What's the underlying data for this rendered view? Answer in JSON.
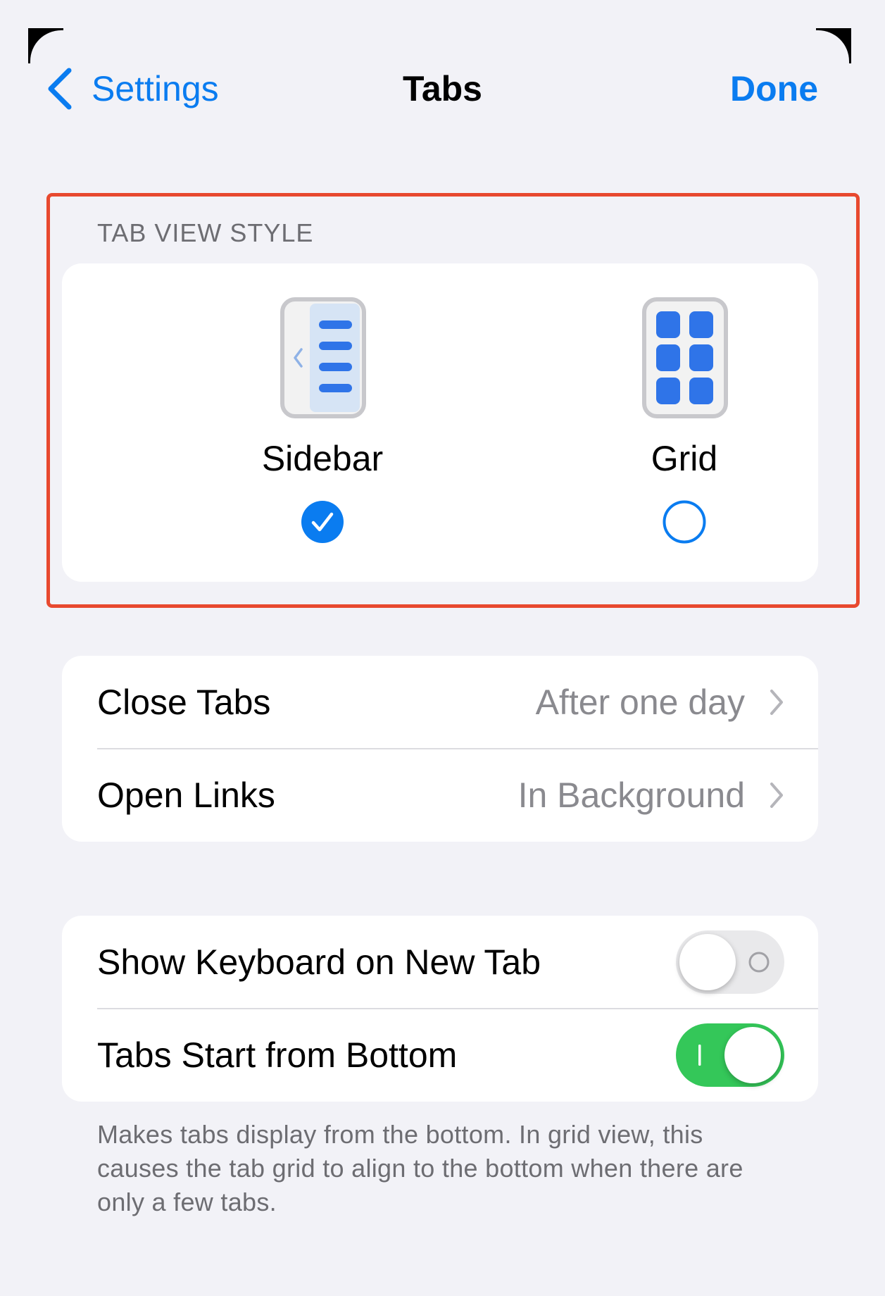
{
  "navbar": {
    "back_label": "Settings",
    "title": "Tabs",
    "done_label": "Done"
  },
  "tab_view_style": {
    "header": "TAB VIEW STYLE",
    "options": [
      {
        "label": "Sidebar",
        "icon": "sidebar-layout-icon",
        "selected": true
      },
      {
        "label": "Grid",
        "icon": "grid-layout-icon",
        "selected": false
      }
    ]
  },
  "tab_settings": {
    "rows": [
      {
        "label": "Close Tabs",
        "value": "After one day"
      },
      {
        "label": "Open Links",
        "value": "In Background"
      }
    ]
  },
  "toggles": {
    "rows": [
      {
        "label": "Show Keyboard on New Tab",
        "on": false
      },
      {
        "label": "Tabs Start from Bottom",
        "on": true
      }
    ],
    "footnote": "Makes tabs display from the bottom. In grid view, this causes the tab grid to align to the bottom when there are only a few tabs."
  },
  "colors": {
    "accent": "#0a7cf0",
    "toggle_on": "#34c759",
    "toggle_off": "#e9e9eb",
    "highlight": "#e8492f"
  }
}
